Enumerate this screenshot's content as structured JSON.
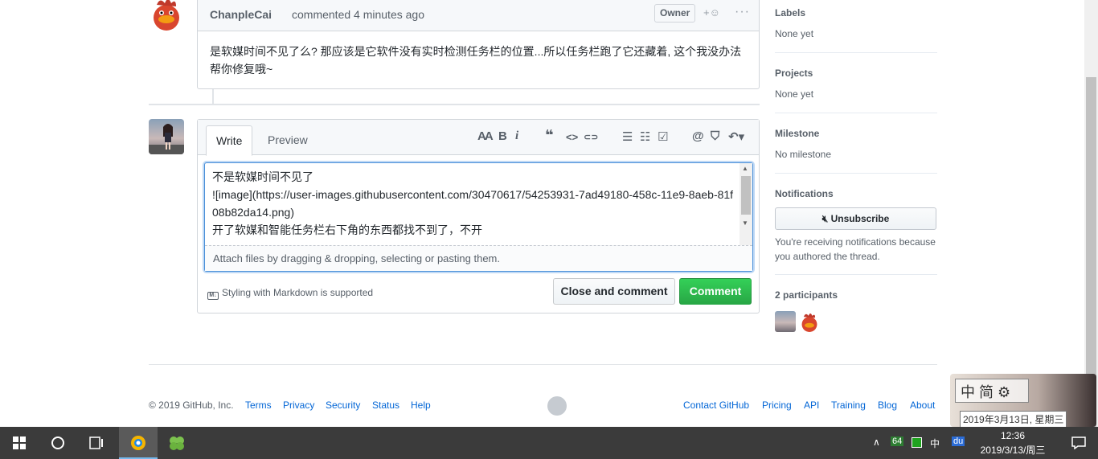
{
  "comment": {
    "author": "ChanpleCai",
    "action": "commented 4 minutes ago",
    "badge": "Owner",
    "emoji_button": "+☺",
    "more_button": "···",
    "body": "是软媒时间不见了么? 那应该是它软件没有实时检测任务栏的位置...所以任务栏跑了它还藏着, 这个我没办法帮你修复哦~"
  },
  "editor": {
    "tab_write": "Write",
    "tab_preview": "Preview",
    "toolbar": {
      "header": "AA",
      "bold": "B",
      "italic": "i",
      "quote": "❝",
      "code": "<>",
      "link": "⊂⊃",
      "ul": "☰",
      "ol": "☷",
      "tasklist": "☑",
      "mention": "@",
      "reference": "⛉",
      "reply": "↶▾"
    },
    "textarea_value": "不是软媒时间不见了\n![image](https://user-images.githubusercontent.com/30470617/54253931-7ad49180-458c-11e9-8aeb-81f08b82da14.png)\n开了软媒和智能任务栏右下角的东西都找不到了，不开",
    "attach_text": "Attach files by dragging & dropping, selecting or pasting them.",
    "markdown_note": "Styling with Markdown is supported",
    "markdown_badge": "M↓",
    "close_button": "Close and comment",
    "comment_button": "Comment"
  },
  "sidebar": {
    "labels_title": "Labels",
    "labels_value": "None yet",
    "projects_title": "Projects",
    "projects_value": "None yet",
    "milestone_title": "Milestone",
    "milestone_value": "No milestone",
    "notifications_title": "Notifications",
    "unsubscribe_button": "Unsubscribe",
    "notifications_text": "You're receiving notifications because you authored the thread.",
    "participants_title": "2 participants"
  },
  "footer": {
    "copyright": "© 2019 GitHub, Inc.",
    "left_links": [
      "Terms",
      "Privacy",
      "Security",
      "Status",
      "Help"
    ],
    "right_links": [
      "Contact GitHub",
      "Pricing",
      "API",
      "Training",
      "Blog",
      "About"
    ]
  },
  "ime": {
    "mode": "中 简 ⚙",
    "date": "2019年3月13日, 星期三"
  },
  "taskbar": {
    "tray_up": "∧",
    "tray_64": "64",
    "tray_lang": "中",
    "tray_du": "du",
    "time": "12:36",
    "date": "2019/3/13/周三"
  },
  "colors": {
    "link": "#0366d6",
    "comment_button": "#2ea44f",
    "taskbar": "#3b3b3b"
  }
}
